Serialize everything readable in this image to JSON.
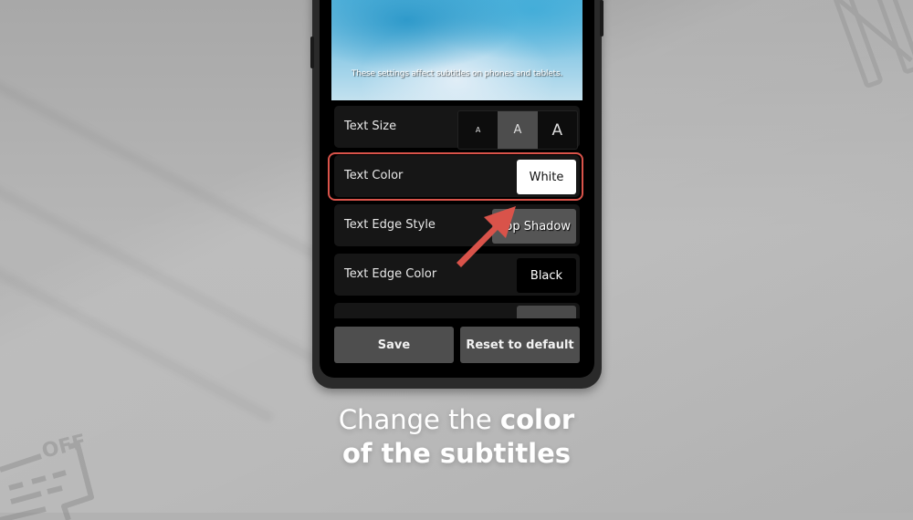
{
  "preview": {
    "caption": "These settings affect subtitles on phones and tablets."
  },
  "settings": {
    "text_size": {
      "label": "Text Size",
      "options": [
        "A",
        "A",
        "A"
      ],
      "selected_index": 1
    },
    "text_color": {
      "label": "Text Color",
      "value": "White"
    },
    "text_edge_style": {
      "label": "Text Edge Style",
      "value": "Drop Shadow",
      "visible_value": "op Shadow"
    },
    "text_edge_color": {
      "label": "Text Edge Color",
      "value": "Black"
    }
  },
  "actions": {
    "save_label": "Save",
    "reset_label": "Reset to default"
  },
  "caption": {
    "line1_light": "Change the ",
    "line1_bold": "color",
    "line2_bold": "of the subtitles"
  },
  "colors": {
    "highlight": "#d9534a",
    "arrow": "#d9534a"
  },
  "decorations": {
    "bottom_left_icon": "subtitles-off-icon",
    "top_right_icon": "netflix-logo-icon",
    "off_text": "OFF"
  }
}
